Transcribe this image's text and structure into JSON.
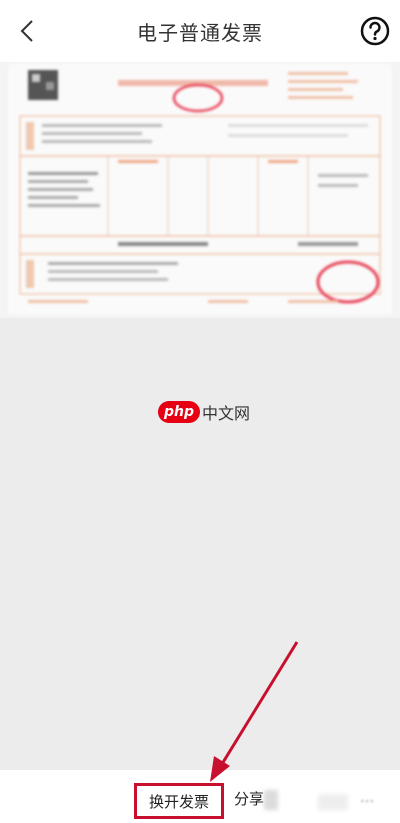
{
  "header": {
    "title": "电子普通发票",
    "back_icon": "chevron-left-icon",
    "help_icon": "question-circle-icon"
  },
  "watermark": {
    "logo_text": "php",
    "site_text": "中文网"
  },
  "bottom_bar": {
    "change_invoice_label": "换开发票",
    "share_label": "分享",
    "more_label": "..."
  },
  "colors": {
    "highlight_red": "#c8102e",
    "stamp_red": "#e8455a",
    "background_gray": "#ececec"
  }
}
